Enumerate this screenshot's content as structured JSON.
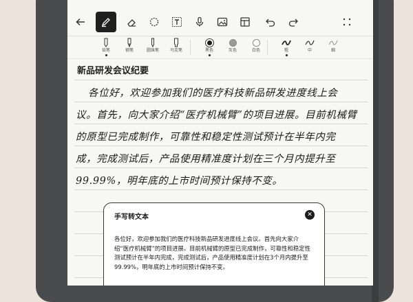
{
  "toolbar": {
    "icons": [
      "back-arrow-icon",
      "pen-icon",
      "eraser-icon",
      "lasso-icon",
      "text-icon",
      "mic-icon",
      "image-icon",
      "template-icon",
      "undo-icon",
      "redo-icon",
      "more-icon"
    ],
    "active": "pen-icon"
  },
  "pens": {
    "items": [
      {
        "label": "铅笔"
      },
      {
        "label": "钢笔"
      },
      {
        "label": "圆珠笔"
      },
      {
        "label": "马克笔"
      }
    ],
    "selected_index": 0
  },
  "colors": {
    "items": [
      {
        "label": "黑色",
        "hex": "#1a1a1a"
      },
      {
        "label": "灰色",
        "hex": "#9a9a9a"
      },
      {
        "label": "白色",
        "hex": "#ffffff"
      }
    ],
    "selected_index": 0
  },
  "thickness": {
    "items": [
      {
        "label": "粗"
      },
      {
        "label": "中"
      },
      {
        "label": "细"
      }
    ],
    "selected_index": 0
  },
  "note": {
    "title": "新品研发会议纪要",
    "handwriting_lines": [
      "各位好，欢迎参加我们的医疗科技新品研发进度线上会",
      "议。首先，向大家介绍“医疗机械臂”的项目进展。目前机械臂",
      "的原型已完成制作，可靠性和稳定性测试预计在半年内完",
      "成，完成测试后，产品使用精准度计划在三个月内提升至",
      "99.99%，明年底的上市时间预计保持不变。"
    ]
  },
  "conversion": {
    "title": "手写转文本",
    "close_icon": "close-icon",
    "text": "各位好，欢迎参加我们的医疗科技新品研发进度线上会议。首先向大家介绍“医疗机械臂”的项目进展。目前机械臂的原型已完成制作，可靠性和稳定性测试预计在半年内完成，完成测试后，产品使用精准度计划在3个月内提升至99.99%，明年底的上市时间预计保持不变。"
  },
  "accent_color": "#1f1f1f"
}
